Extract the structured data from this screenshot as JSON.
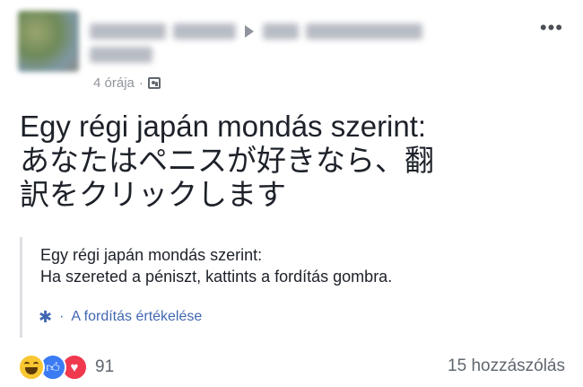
{
  "header": {
    "timestamp": "4 órája",
    "separator": "·",
    "audience_icon": "group-icon",
    "more_label": "•••"
  },
  "post": {
    "lines": [
      "Egy régi japán mondás szerint:",
      "あなたはペニスが好きなら、翻",
      "訳をクリックします"
    ]
  },
  "translation": {
    "lines": [
      "Egy régi japán mondás szerint:",
      "Ha szereted a péniszt, kattints a fordítás gombra."
    ],
    "gear_icon": "gear-icon",
    "separator": "·",
    "rate_label": "A fordítás értékelése"
  },
  "footer": {
    "reaction_icons": [
      "haha-icon",
      "like-icon",
      "love-icon"
    ],
    "reaction_count": "91",
    "comments_label": "15 hozzászólás"
  },
  "colors": {
    "link": "#4267b2",
    "muted": "#90949c",
    "text": "#1d2129",
    "like": "#3b7cf4",
    "love": "#f0384e",
    "haha": "#f7c631"
  }
}
